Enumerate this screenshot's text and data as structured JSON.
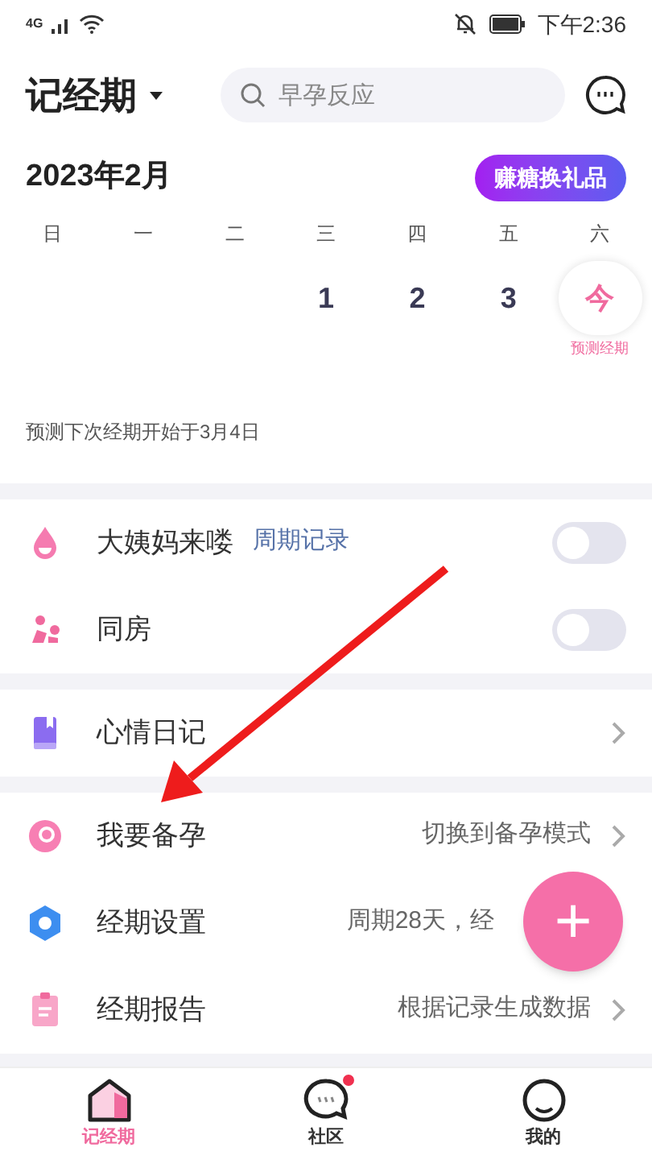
{
  "status_bar": {
    "network": "4G",
    "time": "下午2:36"
  },
  "header": {
    "title": "记经期",
    "search": {
      "placeholder": "早孕反应"
    }
  },
  "calendar": {
    "month": "2023年2月",
    "reward_button": "赚糖换礼品",
    "weekdays": [
      "日",
      "一",
      "二",
      "三",
      "四",
      "五",
      "六"
    ],
    "days": [
      {
        "label": "1",
        "today": false
      },
      {
        "label": "2",
        "today": false
      },
      {
        "label": "3",
        "today": false
      },
      {
        "label": "今",
        "today": true,
        "note": "预测经期"
      }
    ],
    "prediction": "预测下次经期开始于3月4日"
  },
  "groups": [
    {
      "rows": [
        {
          "kind": "toggle",
          "label": "大姨妈来喽",
          "tag": "周期记录",
          "on": false
        },
        {
          "kind": "toggle",
          "label": "同房",
          "on": false
        }
      ]
    },
    {
      "rows": [
        {
          "kind": "link",
          "label": "心情日记"
        }
      ]
    },
    {
      "rows": [
        {
          "kind": "link",
          "label": "我要备孕",
          "value": "切换到备孕模式"
        },
        {
          "kind": "link",
          "label": "经期设置",
          "value": "周期28天，经",
          "under_fab": true
        },
        {
          "kind": "link",
          "label": "经期报告",
          "value": "根据记录生成数据"
        }
      ]
    }
  ],
  "fab": {
    "symbol": "+"
  },
  "tabs": [
    {
      "label": "记经期",
      "selected": true,
      "badge": false
    },
    {
      "label": "社区",
      "selected": false,
      "badge": true
    },
    {
      "label": "我的",
      "selected": false,
      "badge": false
    }
  ]
}
